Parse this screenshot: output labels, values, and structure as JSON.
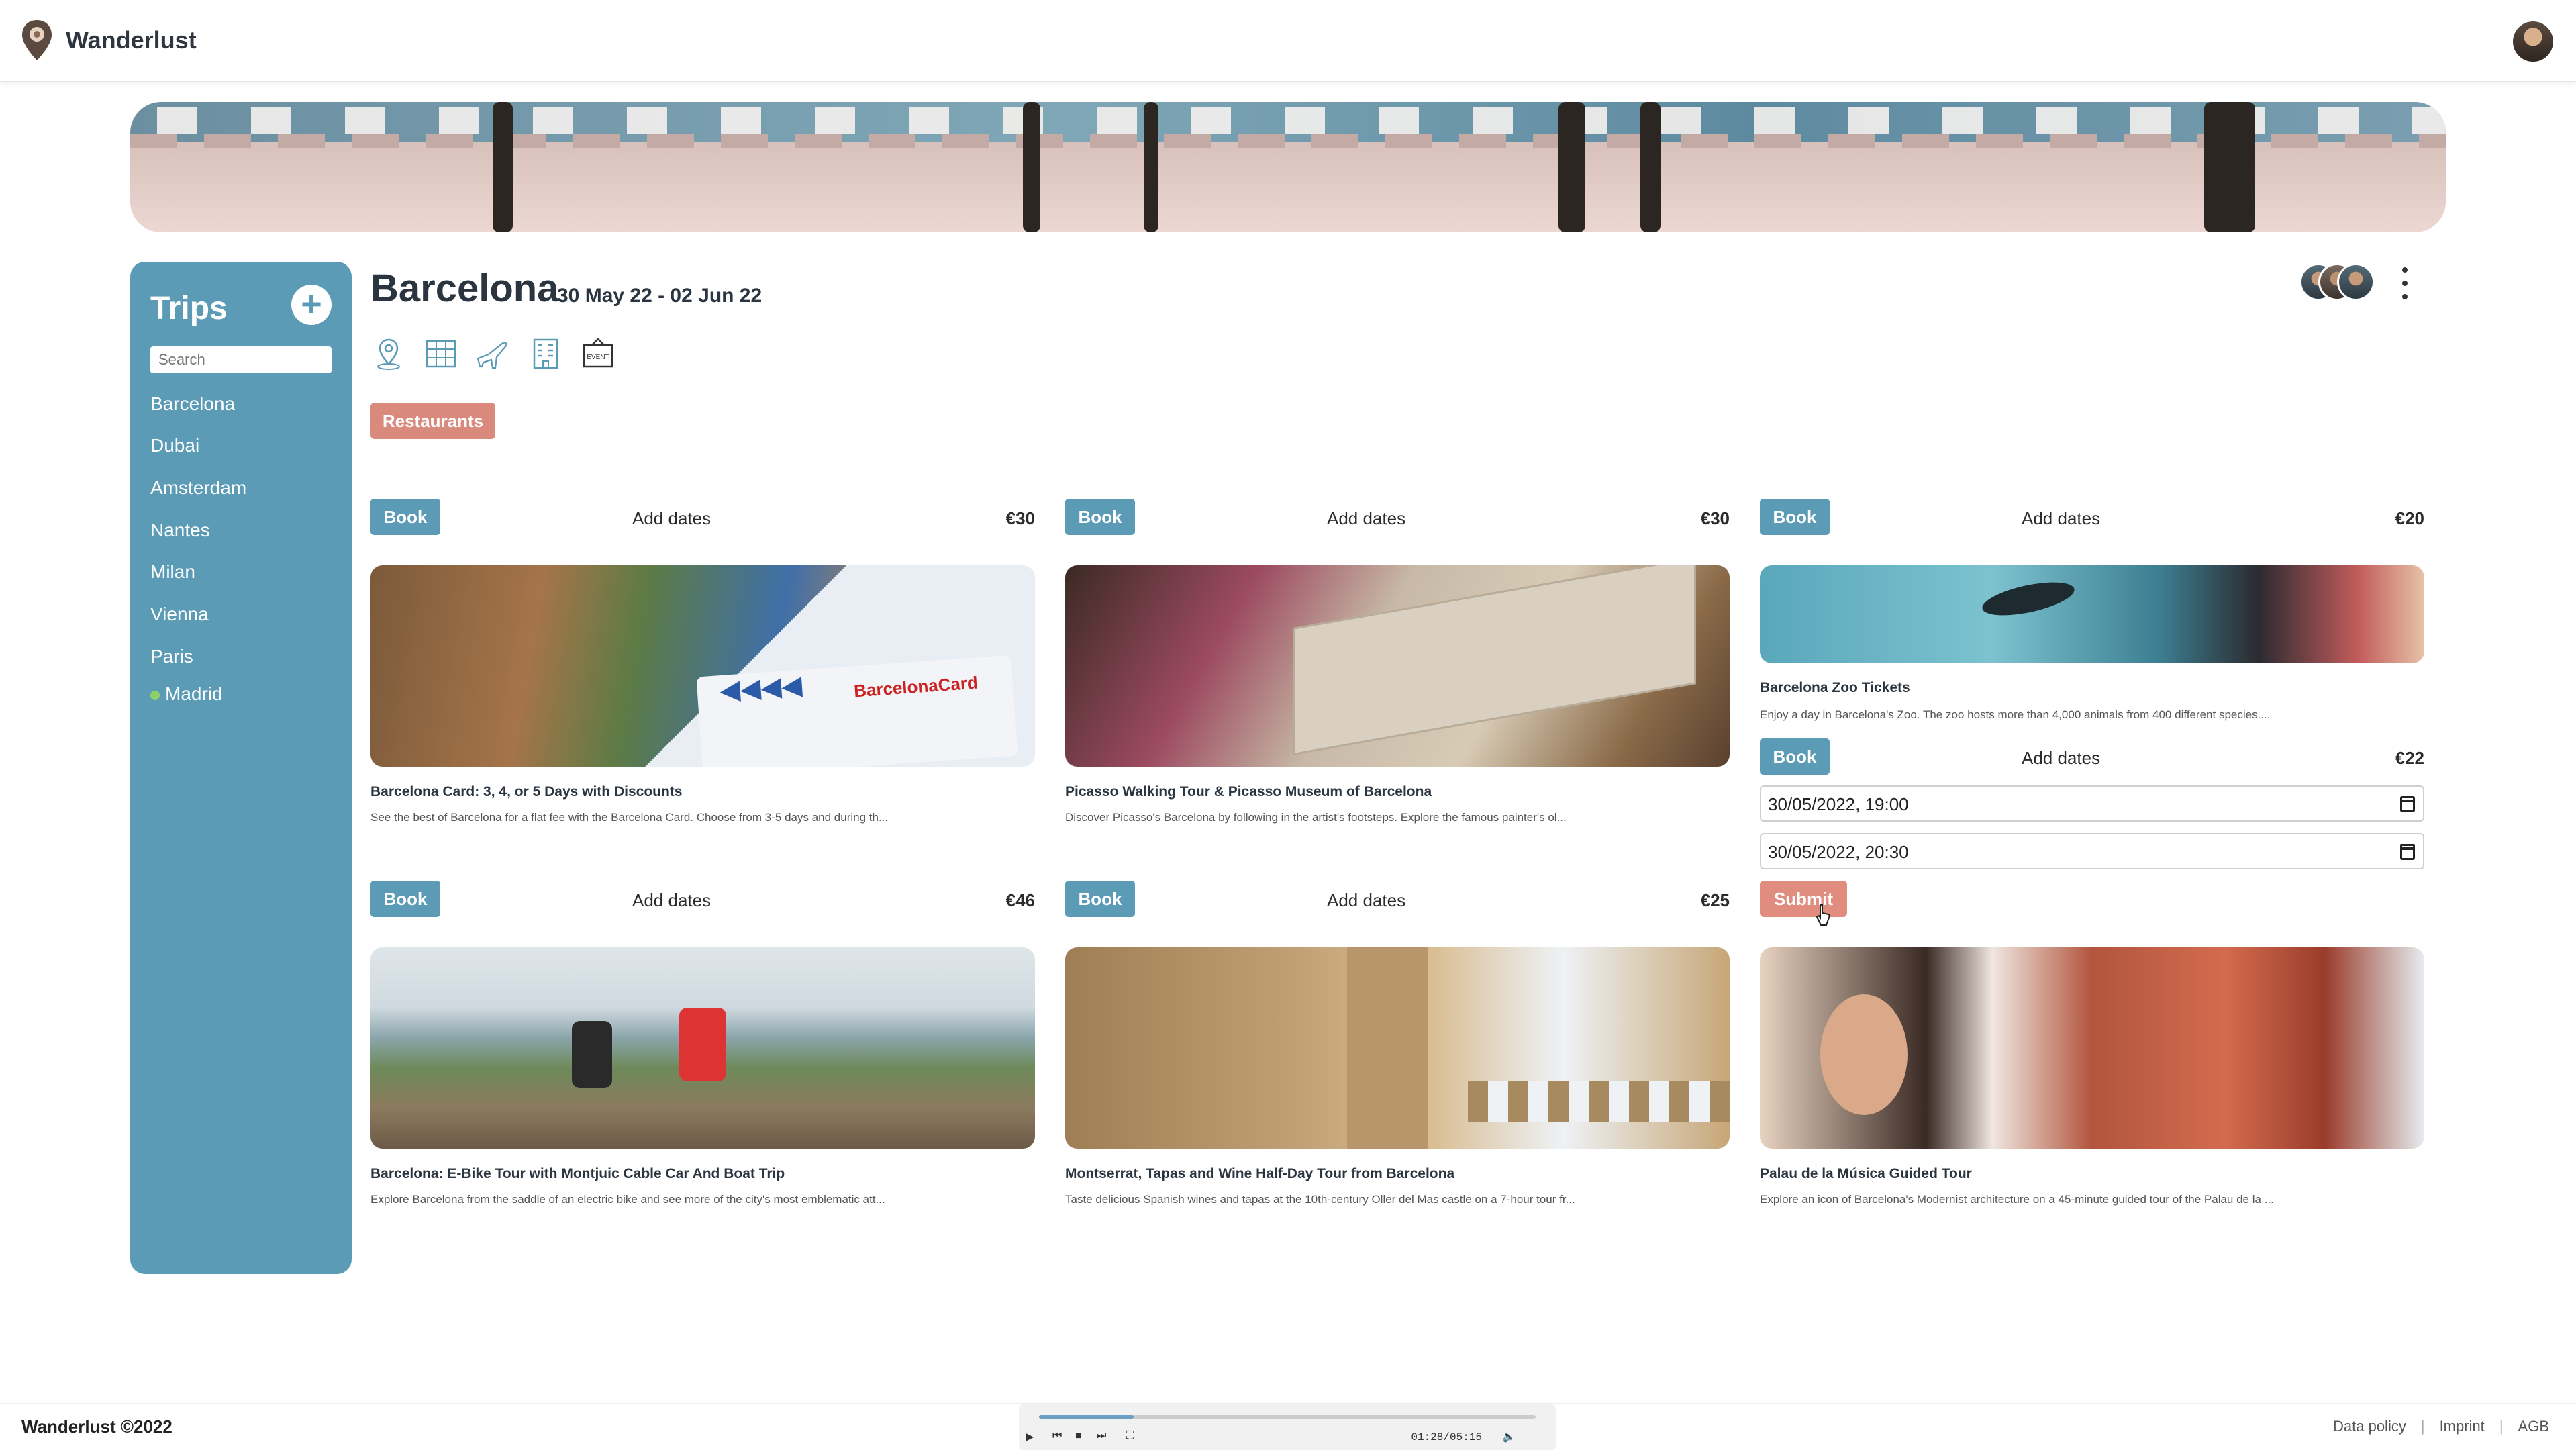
{
  "app": {
    "name": "Wanderlust"
  },
  "sidebar": {
    "title": "Trips",
    "search_placeholder": "Search",
    "items": [
      {
        "label": "Barcelona"
      },
      {
        "label": "Dubai"
      },
      {
        "label": "Amsterdam"
      },
      {
        "label": "Nantes"
      },
      {
        "label": "Milan"
      },
      {
        "label": "Vienna"
      },
      {
        "label": "Paris"
      },
      {
        "label": "Madrid",
        "status_dot": "green"
      }
    ]
  },
  "trip": {
    "title": "Barcelona",
    "dates": "30 May 22 - 02 Jun 22",
    "category_icons": [
      "location-pin-icon",
      "map-grid-icon",
      "airplane-icon",
      "hotel-icon",
      "event-icon"
    ],
    "active_filter": "Restaurants"
  },
  "cards": [
    {
      "book": "Book",
      "add_dates": "Add dates",
      "price": "€30",
      "title": "Barcelona Card: 3, 4, or 5 Days with Discounts",
      "desc": "See the best of Barcelona for a flat fee with the Barcelona Card. Choose from 3-5 days and during th..."
    },
    {
      "book": "Book",
      "add_dates": "Add dates",
      "price": "€30",
      "title": "Picasso Walking Tour & Picasso Museum of Barcelona",
      "desc": "Discover Picasso's Barcelona by following in the artist's footsteps. Explore the famous painter's ol..."
    },
    {
      "book": "Book",
      "add_dates": "Add dates",
      "price": "€20",
      "title": "Barcelona Zoo Tickets",
      "desc": "Enjoy a day in Barcelona's Zoo. The zoo hosts more than 4,000 animals from 400 different species...."
    },
    {
      "book": "Book",
      "add_dates": "Add dates",
      "price": "€46",
      "title": "Barcelona: E-Bike Tour with Montjuic Cable Car And Boat Trip",
      "desc": "Explore Barcelona from the saddle of an electric bike and see more of the city's most emblematic att..."
    },
    {
      "book": "Book",
      "add_dates": "Add dates",
      "price": "€25",
      "title": "Montserrat, Tapas and Wine Half-Day Tour from Barcelona",
      "desc": "Taste delicious Spanish wines and tapas at the 10th-century Oller del Mas castle on a 7-hour tour fr..."
    },
    {
      "book": "Book",
      "add_dates": "Add dates",
      "price": "€22",
      "title": "Palau de la Música Guided Tour",
      "desc": "Explore an icon of Barcelona's Modernist architecture on a 45-minute guided tour of the Palau de la ..."
    }
  ],
  "date_form": {
    "start": "30/05/2022, 19:00",
    "end": "30/05/2022, 20:30",
    "submit": "Submit"
  },
  "footer": {
    "copyright": "Wanderlust ©2022",
    "links": [
      "Data policy",
      "Imprint",
      "AGB"
    ]
  },
  "player": {
    "time": "01:28/05:15",
    "progress": 0.19
  },
  "colors": {
    "sidebar": "#5b9bb5",
    "book_button": "#5b9bb5",
    "filter_chip": "#d98a7d",
    "submit_button": "#e08d80"
  }
}
